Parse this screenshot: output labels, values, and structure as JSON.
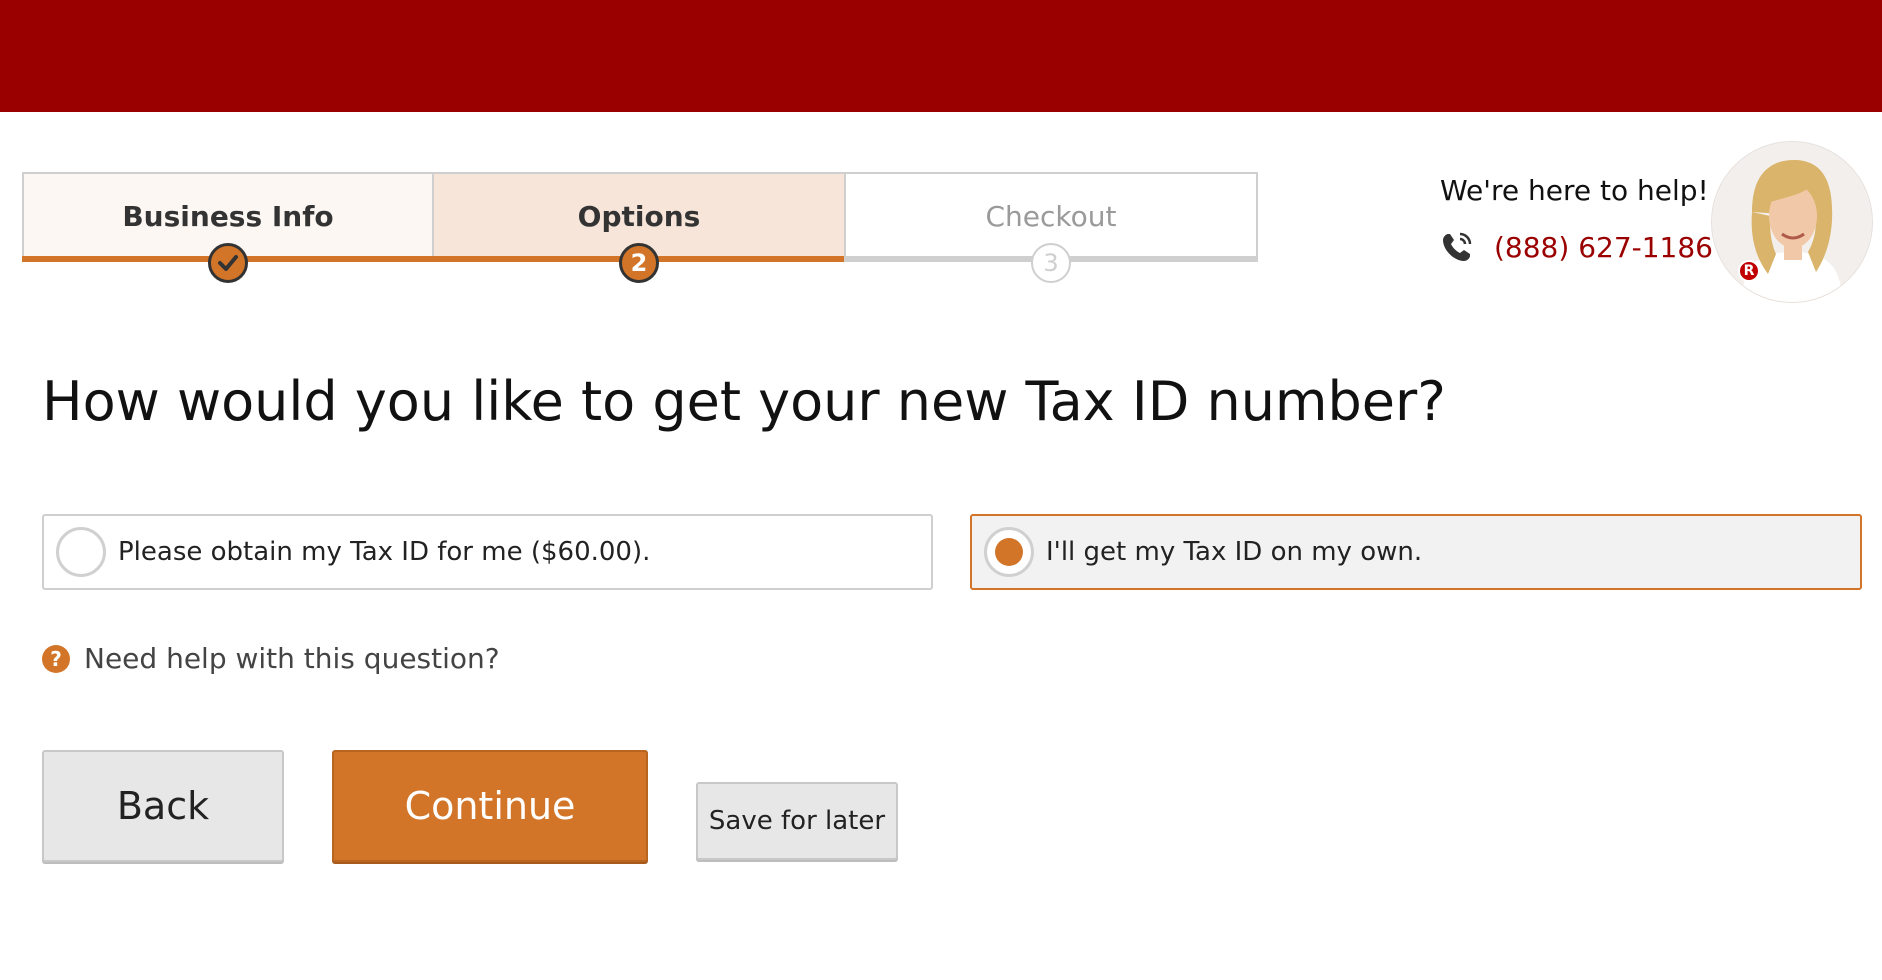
{
  "stepper": {
    "steps": [
      {
        "label": "Business Info",
        "state": "completed",
        "marker_icon": "check-icon"
      },
      {
        "label": "Options",
        "state": "current",
        "marker": "2"
      },
      {
        "label": "Checkout",
        "state": "upcoming",
        "marker": "3"
      }
    ]
  },
  "help": {
    "text": "We're here to help!",
    "phone_icon": "phone-icon",
    "phone": "(888) 627-1186",
    "avatar_badge": "R"
  },
  "question": {
    "text": "How would you like to get your new Tax ID number?",
    "options": [
      {
        "label": "Please obtain my Tax ID for me ($60.00).",
        "selected": false
      },
      {
        "label": "I'll get my Tax ID on my own.",
        "selected": true
      }
    ],
    "help_icon": "question-icon",
    "help_link": "Need help with this question?"
  },
  "buttons": {
    "back": "Back",
    "continue": "Continue",
    "save": "Save for later"
  },
  "colors": {
    "topbar": "#9a0000",
    "accent": "#d27528",
    "phone_text": "#9a0000"
  }
}
